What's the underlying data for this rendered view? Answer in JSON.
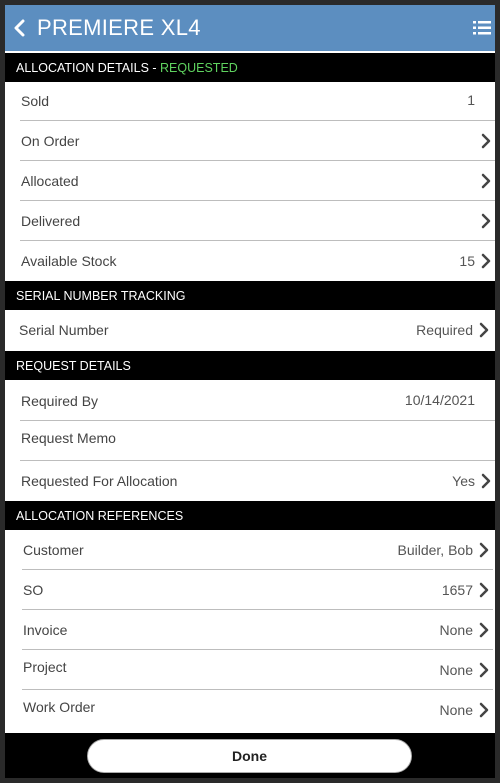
{
  "header": {
    "title": "PREMIERE XL4"
  },
  "sections": {
    "allocation_details": {
      "title": "ALLOCATION DETAILS",
      "separator": " - ",
      "status": "REQUESTED",
      "rows": [
        {
          "label": "Sold",
          "value": "1"
        },
        {
          "label": "On Order",
          "value": ""
        },
        {
          "label": "Allocated",
          "value": ""
        },
        {
          "label": "Delivered",
          "value": ""
        },
        {
          "label": "Available Stock",
          "value": "15"
        }
      ]
    },
    "serial_tracking": {
      "title": "SERIAL NUMBER TRACKING",
      "rows": [
        {
          "label": "Serial Number",
          "value": "Required"
        }
      ]
    },
    "request_details": {
      "title": "REQUEST DETAILS",
      "rows": [
        {
          "label": "Required By",
          "value": "10/14/2021"
        },
        {
          "label": "Request Memo",
          "value": ""
        },
        {
          "label": "Requested For Allocation",
          "value": "Yes"
        }
      ]
    },
    "allocation_references": {
      "title": "ALLOCATION REFERENCES",
      "rows": [
        {
          "label": "Customer",
          "value": "Builder, Bob"
        },
        {
          "label": "SO",
          "value": "1657"
        },
        {
          "label": "Invoice",
          "value": "None"
        },
        {
          "label": "Project",
          "value": "None"
        },
        {
          "label": "Work Order",
          "value": "None"
        }
      ]
    }
  },
  "footer": {
    "done_label": "Done"
  },
  "colors": {
    "header_bg": "#5c8ec0",
    "status_green": "#5fd35f",
    "section_bg": "#000000"
  },
  "icons": {
    "back": "chevron-left-icon",
    "menu": "list-menu-icon",
    "row": "chevron-right-icon"
  }
}
